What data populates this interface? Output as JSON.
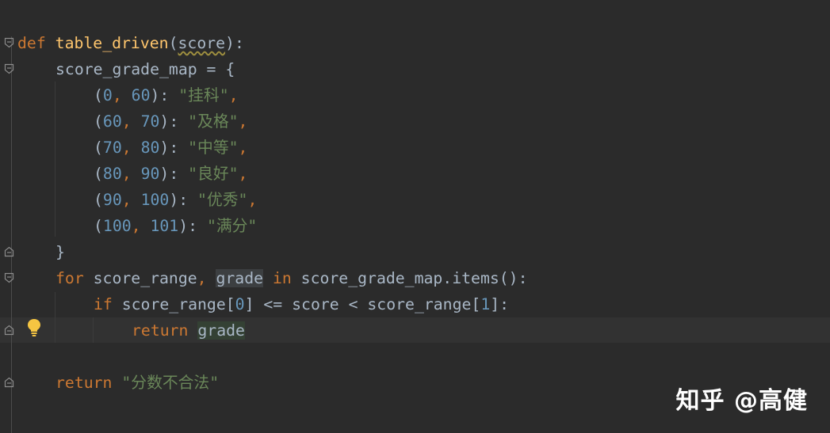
{
  "editor": {
    "colors": {
      "background": "#2b2b2b",
      "keyword": "#cc7832",
      "function": "#ffc66d",
      "number": "#6897bb",
      "string": "#6a8759",
      "text": "#a9b7c6"
    },
    "lines": {
      "l1": {
        "kw_def": "def",
        "fn_name": "table_driven",
        "p_open": "(",
        "param": "score",
        "p_close": "):"
      },
      "l2": {
        "text": "score_grade_map = {"
      },
      "rows": [
        {
          "open": "(",
          "a": "0",
          "sep": ", ",
          "b": "60",
          "close": "): ",
          "value": "\"挂科\"",
          "comma": ","
        },
        {
          "open": "(",
          "a": "60",
          "sep": ", ",
          "b": "70",
          "close": "): ",
          "value": "\"及格\"",
          "comma": ","
        },
        {
          "open": "(",
          "a": "70",
          "sep": ", ",
          "b": "80",
          "close": "): ",
          "value": "\"中等\"",
          "comma": ","
        },
        {
          "open": "(",
          "a": "80",
          "sep": ", ",
          "b": "90",
          "close": "): ",
          "value": "\"良好\"",
          "comma": ","
        },
        {
          "open": "(",
          "a": "90",
          "sep": ", ",
          "b": "100",
          "close": "): ",
          "value": "\"优秀\"",
          "comma": ","
        },
        {
          "open": "(",
          "a": "100",
          "sep": ", ",
          "b": "101",
          "close": "): ",
          "value": "\"满分\"",
          "comma": ""
        }
      ],
      "l9": {
        "text": "}"
      },
      "l10": {
        "kw_for": "for",
        "var1": " score_range",
        "comma": ", ",
        "var2": "grade",
        "kw_in": " in ",
        "rest": "score_grade_map.items():"
      },
      "l11": {
        "kw_if": "if",
        "part1": " score_range[",
        "n0": "0",
        "part2": "] <= score < score_range[",
        "n1": "1",
        "part3": "]:"
      },
      "l12": {
        "kw_return": "return",
        "space": " ",
        "var": "grade"
      },
      "l14": {
        "kw_return": "return",
        "space": " ",
        "str": "\"分数不合法\""
      }
    },
    "icons": {
      "fold": "fold-marker-icon",
      "bulb": "lightbulb-icon"
    }
  },
  "watermark": {
    "text": "知乎 @高健"
  }
}
